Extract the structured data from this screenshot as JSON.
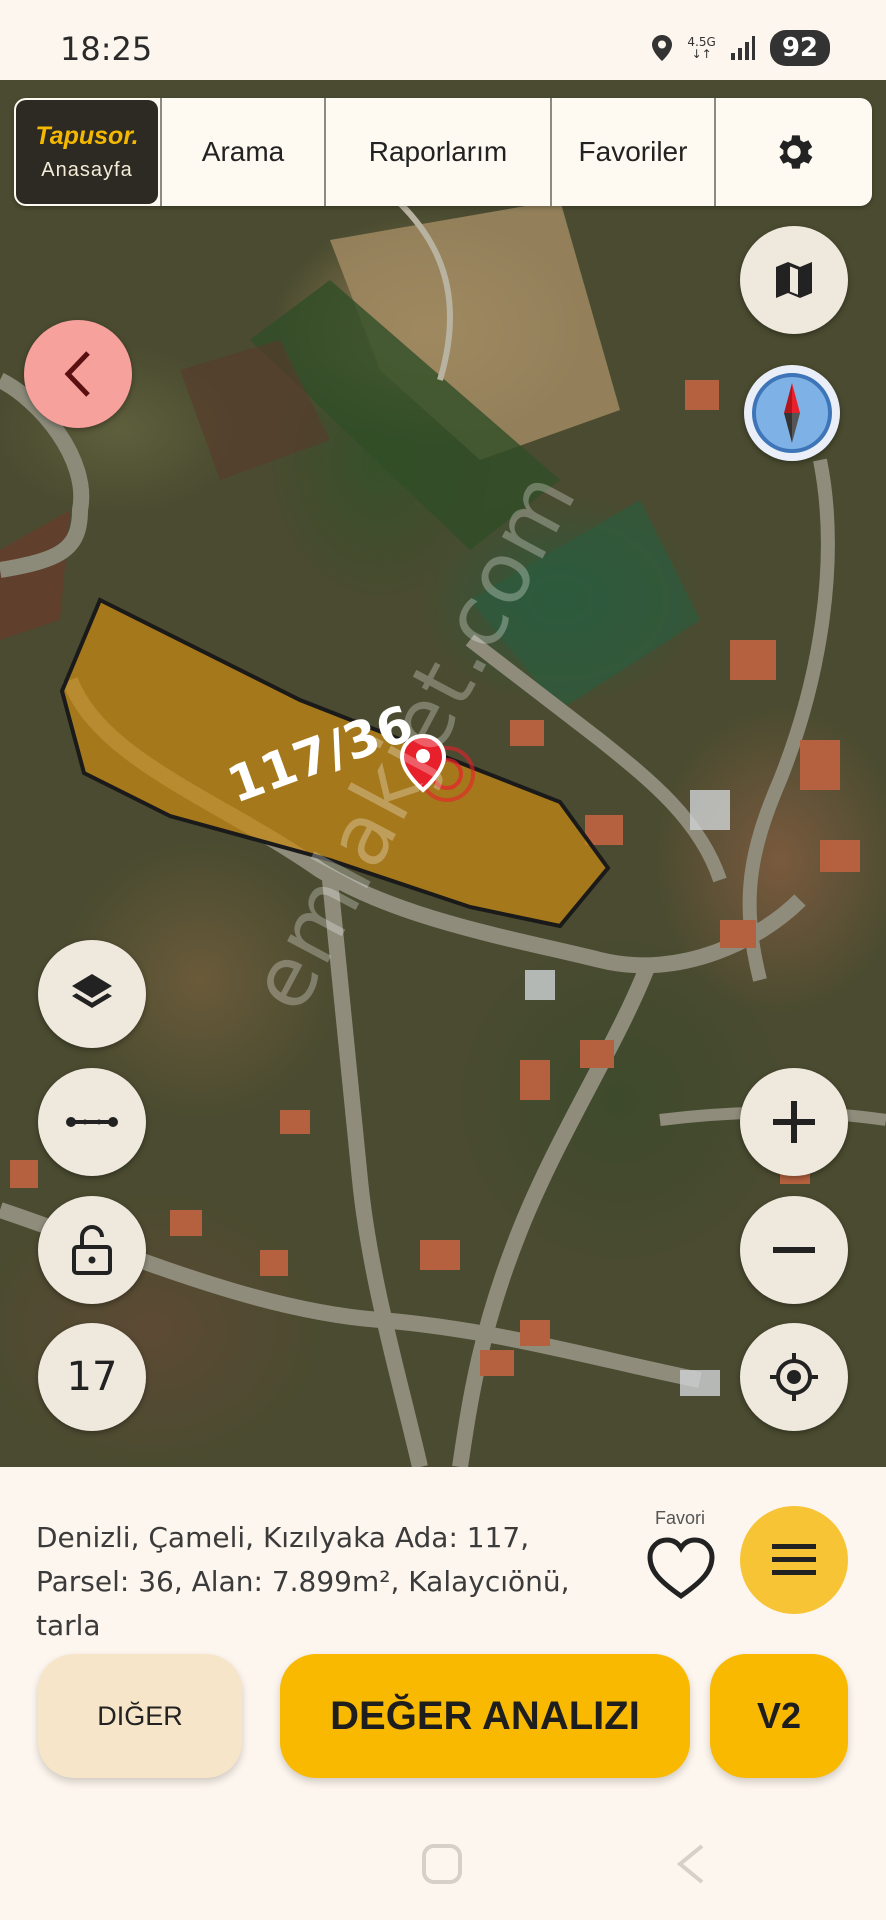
{
  "status": {
    "time": "18:25",
    "network_top": "4.5G",
    "network_bottom": "↓↑",
    "battery": "92"
  },
  "nav": {
    "logo_brand": "Tapusor.",
    "logo_home": "Anasayfa",
    "items": [
      {
        "label": "Arama"
      },
      {
        "label": "Raporlarım"
      },
      {
        "label": "Favoriler"
      }
    ],
    "settings_icon": "gear-icon"
  },
  "map": {
    "parcel_label": "117/36",
    "zoom_level": "17",
    "watermark": "emlakjet.com",
    "parcel_color": "#c98a14",
    "accent_marker": "#e8202c"
  },
  "info": {
    "text": "Denizli, Çameli, Kızılyaka Ada: 117, Parsel: 36, Alan: 7.899m², Kalaycıönü, tarla",
    "favorite_label": "Favori"
  },
  "actions": {
    "other": "DIĞER",
    "value_analysis": "DEĞER ANALIZI",
    "version": "V2"
  },
  "colors": {
    "primary": "#f8b900",
    "back_button": "#f6a19b",
    "background": "#fdf6ee"
  }
}
